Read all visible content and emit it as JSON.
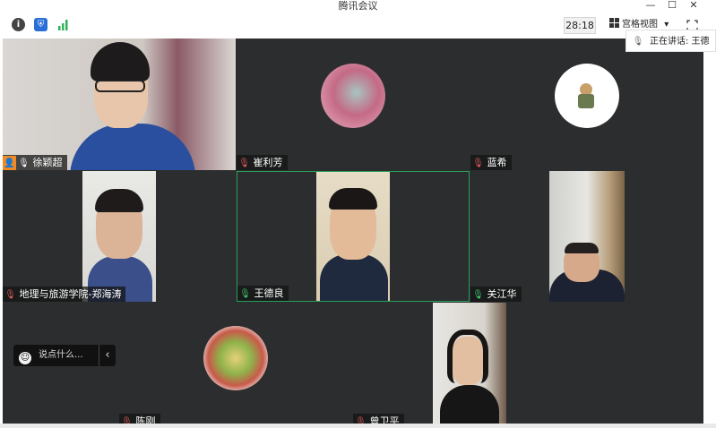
{
  "window": {
    "title": "腾讯会议",
    "minimize": "—",
    "maximize": "☐",
    "close": "✕"
  },
  "toolbar": {
    "info_icon": "info-icon",
    "shield_icon": "shield-icon",
    "signal_icon": "signal-icon",
    "timer": "28:18",
    "view_label": "宫格视图",
    "view_dropdown": "▾",
    "fullscreen_icon": "fullscreen-icon"
  },
  "speaking": {
    "label": "正在讲话: 王德"
  },
  "participants": [
    {
      "name": "徐颖超",
      "type": "video",
      "host": true
    },
    {
      "name": "崔利芳",
      "type": "avatar"
    },
    {
      "name": "蓝希",
      "type": "avatar"
    },
    {
      "name": "地理与旅游学院-郑海涛",
      "type": "video"
    },
    {
      "name": "王德良",
      "type": "video",
      "speaking": true
    },
    {
      "name": "关江华",
      "type": "video",
      "speaking": true
    },
    {
      "name": "陈刚",
      "type": "avatar"
    },
    {
      "name": "曾卫平",
      "type": "video"
    }
  ],
  "chat": {
    "placeholder": "说点什么...",
    "collapse": "‹"
  },
  "colors": {
    "tile_bg": "#2b2d2f",
    "active_border": "#2aa05a",
    "mic_active": "#3ecf6d",
    "host_badge": "#f08a24"
  }
}
